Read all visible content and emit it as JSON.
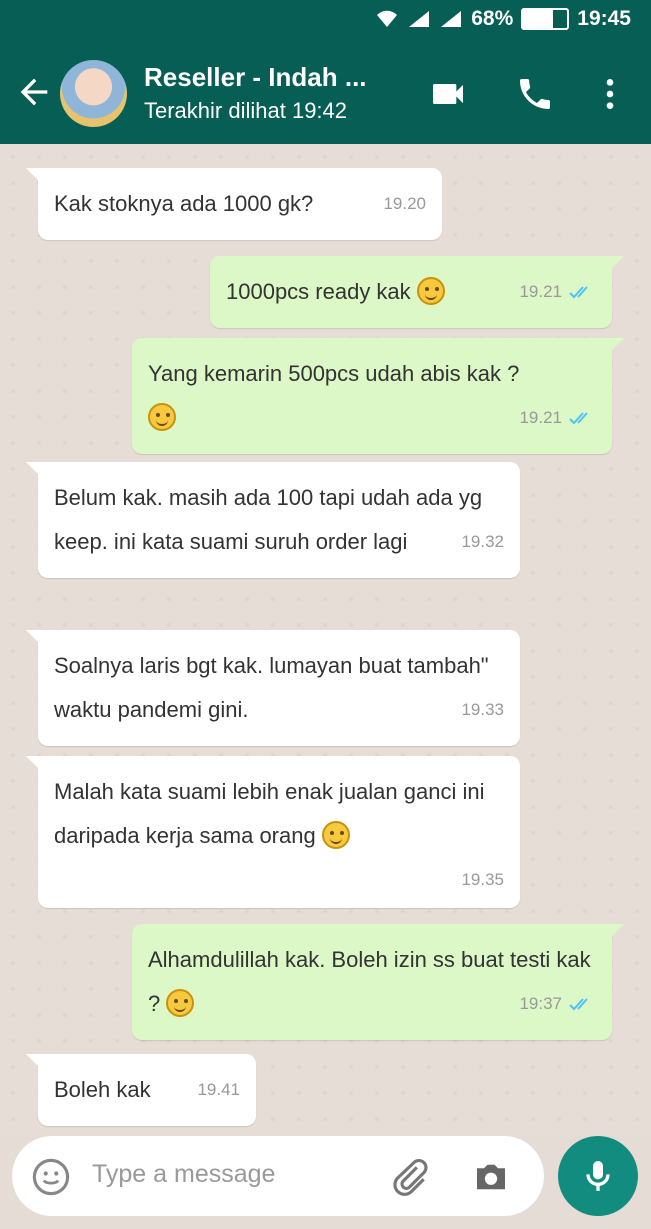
{
  "status_bar": {
    "battery_percent": "68%",
    "battery_level": 0.68,
    "time": "19:45"
  },
  "header": {
    "contact_name": "Reseller - Indah ...",
    "last_seen": "Terakhir dilihat 19:42",
    "icons": [
      "back-arrow-icon",
      "video-call-icon",
      "phone-call-icon",
      "more-options-icon"
    ]
  },
  "messages": [
    {
      "dir": "in",
      "text": "Kak stoknya ada 1000 gk?",
      "time": "19.20"
    },
    {
      "dir": "out",
      "text": "1000pcs ready kak",
      "emoji": "smiling-face",
      "time": "19.21",
      "status": "read"
    },
    {
      "dir": "out",
      "text": "Yang kemarin 500pcs udah abis kak ?",
      "emoji": "smiling-face",
      "time": "19.21",
      "status": "read"
    },
    {
      "dir": "in",
      "text": "Belum kak. masih ada 100 tapi udah ada yg keep. ini kata suami suruh order lagi",
      "time": "19.32"
    },
    {
      "dir": "in",
      "text": "Soalnya laris bgt kak. lumayan buat tambah\" waktu pandemi gini.",
      "time": "19.33"
    },
    {
      "dir": "in",
      "text": "Malah kata suami lebih enak jualan ganci ini daripada kerja sama orang",
      "emoji": "grinning-face",
      "time": "19.35"
    },
    {
      "dir": "out",
      "text": "Alhamdulillah kak. Boleh izin ss buat testi kak ?",
      "emoji": "smiling-face",
      "time": "19:37",
      "status": "read"
    },
    {
      "dir": "in",
      "text": "Boleh kak",
      "time": "19.41"
    }
  ],
  "composer": {
    "placeholder": "Type a message",
    "icons": [
      "emoji-icon",
      "attach-icon",
      "camera-icon",
      "microphone-icon"
    ]
  },
  "colors": {
    "header": "#075e54",
    "outgoing_bubble": "#dcf8c6",
    "incoming_bubble": "#ffffff",
    "mic_button": "#128c7e",
    "read_ticks": "#4fc3f7"
  }
}
